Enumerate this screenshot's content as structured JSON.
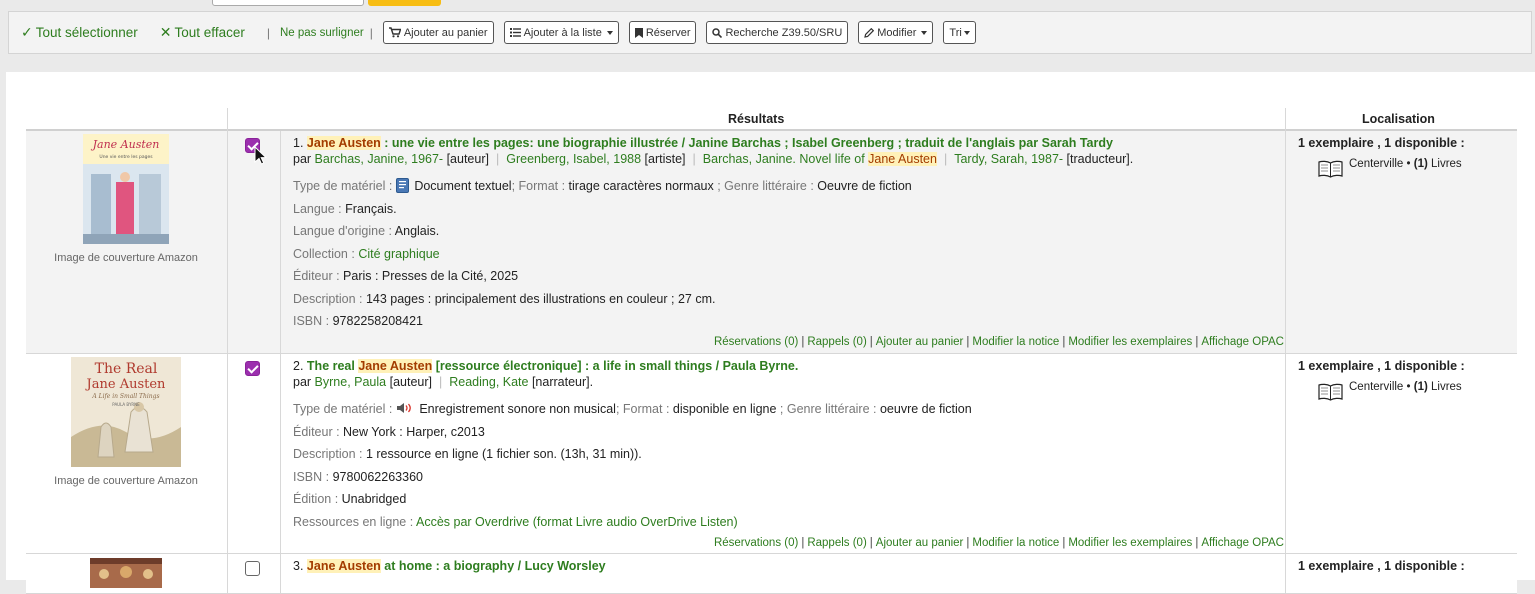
{
  "toolbar": {
    "select_all": "Tout sélectionner",
    "clear_all": "Tout effacer",
    "no_highlight": "Ne pas surligner",
    "separator": "|",
    "add_to_cart": "Ajouter au panier",
    "add_to_list": "Ajouter à la liste",
    "reserve": "Réserver",
    "z3950": "Recherche Z39.50/SRU",
    "modify": "Modifier",
    "sort": "Tri"
  },
  "table": {
    "col_results": "Résultats",
    "col_location": "Localisation"
  },
  "records": [
    {
      "number": "1.",
      "title_hl": "Jane Austen",
      "title_rest": " : une vie entre les pages: une biographie illustrée / Janine Barchas ; Isabel Greenberg ; traduit de l'anglais par Sarah Tardy",
      "by": "par ",
      "a1": "Barchas, Janine, 1967-",
      "a1_role": " [auteur]",
      "a2": "Greenberg, Isabel, 1988",
      "a2_role": " [artiste]",
      "a3_pre": "Barchas, Janine. Novel life of ",
      "a3_hl": "Jane Austen",
      "a4": "Tardy, Sarah, 1987-",
      "a4_role": " [traducteur].",
      "type_label": "Type de matériel : ",
      "type_value": "Document textuel",
      "format_label": "; Format : ",
      "format_value": "tirage caractères normaux",
      "genre_label": " ; Genre littéraire : ",
      "genre_value": "Oeuvre de fiction",
      "lang_label": "Langue : ",
      "lang_value": "Français.",
      "orig_label": "Langue d'origine : ",
      "orig_value": "Anglais.",
      "coll_label": "Collection : ",
      "coll_value": "Cité graphique",
      "pub_label": "Éditeur : ",
      "pub_value": "Paris : Presses de la Cité, 2025",
      "desc_label": "Description : ",
      "desc_value": "143 pages : principalement des illustrations en couleur ; 27 cm.",
      "isbn_label": "ISBN : ",
      "isbn_value": "9782258208421",
      "cover_caption": "Image de couverture Amazon",
      "cover_line1": "Jane Austen",
      "cover_line2": "Une vie entre les pages",
      "loc_head": "1 exemplaire , 1 disponible :",
      "loc_branch": "Centerville • ",
      "loc_count": "(1)",
      "loc_type": " Livres"
    },
    {
      "number": "2.",
      "title_pre": "The real ",
      "title_hl": "Jane Austen",
      "title_rest": " [ressource électronique] : a life in small things / Paula Byrne.",
      "by": "par ",
      "a1": "Byrne, Paula",
      "a1_role": " [auteur]",
      "a2": "Reading, Kate",
      "a2_role": " [narrateur].",
      "type_label": "Type de matériel : ",
      "type_value": "Enregistrement sonore non musical",
      "format_label": "; Format : ",
      "format_value": "disponible en ligne",
      "genre_label": " ; Genre littéraire : ",
      "genre_value": "oeuvre de fiction",
      "pub_label": "Éditeur : ",
      "pub_value": "New York : Harper, c2013",
      "desc_label": "Description : ",
      "desc_value": "1 ressource en ligne (1 fichier son. (13h, 31 min)).",
      "isbn_label": "ISBN : ",
      "isbn_value": "9780062263360",
      "ed_label": "Édition : ",
      "ed_value": "Unabridged",
      "online_label": "Ressources en ligne : ",
      "online_value": "Accès par Overdrive (format Livre audio OverDrive Listen)",
      "cover_caption": "Image de couverture Amazon",
      "cover_line1": "The Real",
      "cover_line2": "Jane Austen",
      "cover_line3": "A Life in Small Things",
      "cover_author": "PAULA BYRNE",
      "loc_head": "1 exemplaire , 1 disponible :",
      "loc_branch": "Centerville • ",
      "loc_count": "(1)",
      "loc_type": " Livres"
    },
    {
      "number": "3.",
      "title_hl": "Jane Austen",
      "title_rest": " at home : a biography / Lucy Worsley",
      "loc_head": "1 exemplaire , 1 disponible :"
    }
  ],
  "actions": {
    "holds": "Réservations (0)",
    "recalls": "Rappels (0)",
    "add_cart": "Ajouter au panier",
    "edit_record": "Modifier la notice",
    "edit_items": "Modifier les exemplaires",
    "opac": "Affichage OPAC",
    "sep": "|"
  },
  "colors": {
    "link": "#2e7d1f",
    "highlight_bg": "#fff1b8",
    "highlight_fg": "#a33c00",
    "checkbox": "#9b2fae",
    "search_button": "#f7bd13"
  },
  "icons": {
    "select_all": "check-icon",
    "clear_all": "times-icon",
    "cart": "cart-icon",
    "list": "list-icon",
    "reserve": "bookmark-icon",
    "search": "search-icon",
    "modify": "pencil-icon",
    "book": "open-book-icon",
    "audio": "speaker-icon",
    "text": "document-icon"
  }
}
